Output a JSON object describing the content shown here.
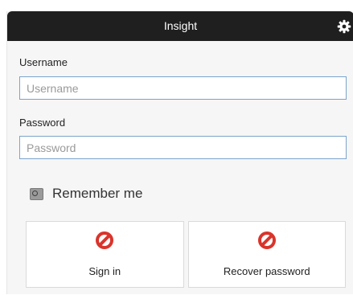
{
  "window": {
    "title": "Insight",
    "settings_icon": "gear-icon"
  },
  "form": {
    "username": {
      "label": "Username",
      "placeholder": "Username",
      "value": ""
    },
    "password": {
      "label": "Password",
      "placeholder": "Password",
      "value": ""
    },
    "remember_me": {
      "label": "Remember me",
      "checked": false
    }
  },
  "actions": {
    "sign_in": {
      "label": "Sign in",
      "icon": "prohibited-icon"
    },
    "recover_password": {
      "label": "Recover password",
      "icon": "prohibited-icon"
    }
  },
  "colors": {
    "titlebar": "#1f1f1f",
    "input_border": "#7ba3c9",
    "icon_red": "#d9342b"
  }
}
